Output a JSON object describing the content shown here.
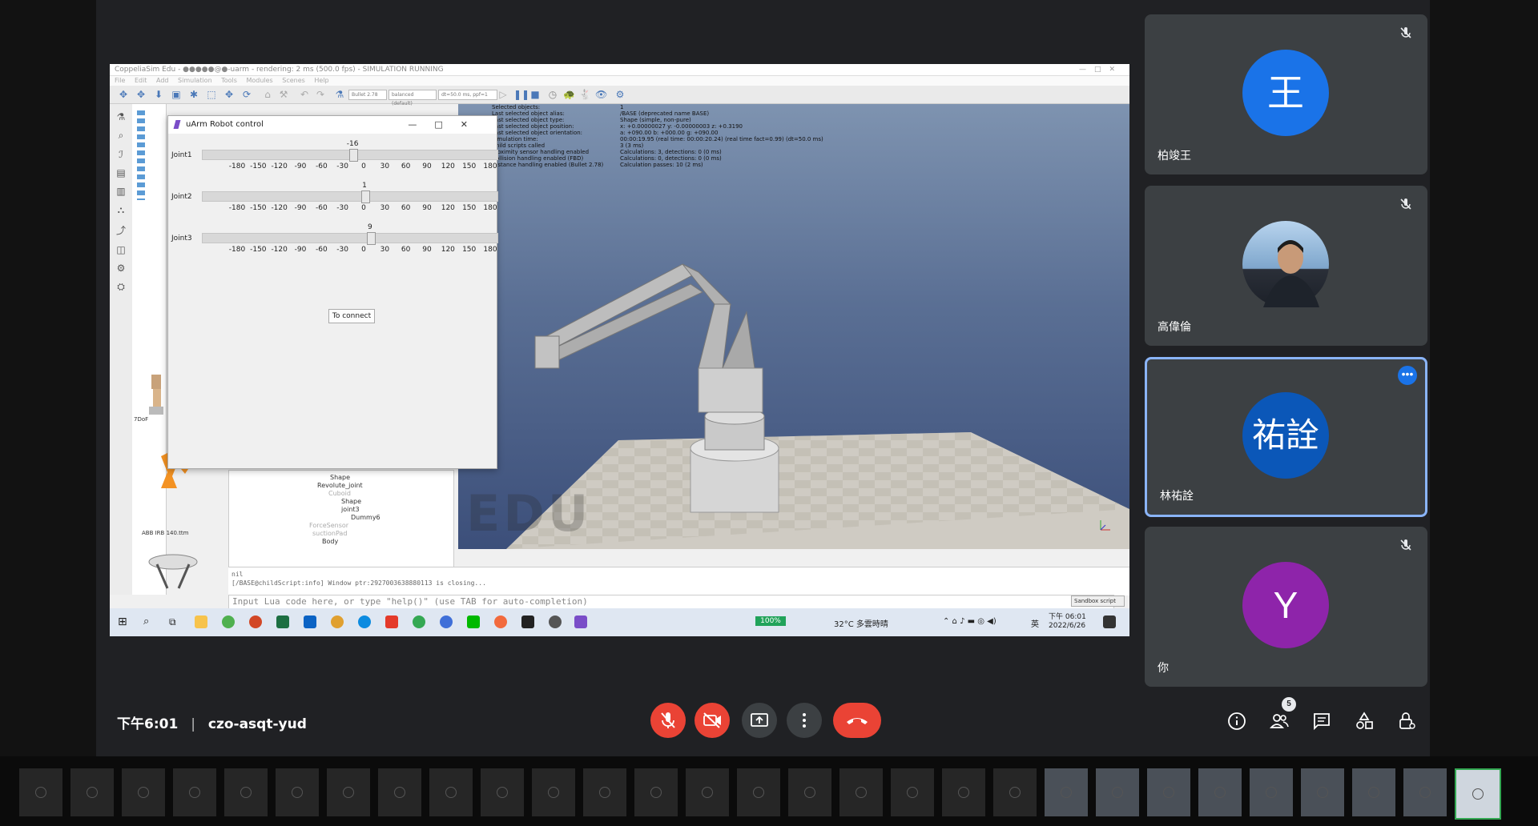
{
  "meeting": {
    "time": "下午6:01",
    "separator": "|",
    "code": "czo-asqt-yud",
    "participants_count": "5"
  },
  "participants": [
    {
      "name": "柏竣王",
      "initial": "王",
      "color": "#1a73e8",
      "muted": true
    },
    {
      "name": "高偉倫",
      "initial": "",
      "color": "#8aa7c4",
      "muted": true
    },
    {
      "name": "林祐詮",
      "initial": "祐詮",
      "color": "#0b57b8",
      "muted": false,
      "active": true
    },
    {
      "name": "你",
      "initial": "Y",
      "color": "#8e24aa",
      "muted": true
    }
  ],
  "controls": {
    "mic": "mic-off-icon",
    "camera": "camera-off-icon",
    "present": "present-screen-icon",
    "more": "more-options-icon",
    "leave": "leave-call-icon"
  },
  "colors": {
    "end_call": "#ea4335",
    "muted_red": "#ea4335",
    "tile_bg": "#3c4043",
    "active_border": "#8ab4f8"
  },
  "shared_screen": {
    "window_title": "CoppeliaSim Edu - ●●●●●@●-uarm - rendering: 2 ms (500.0 fps) - SIMULATION RUNNING",
    "menu": [
      "File",
      "Edit",
      "Add",
      "Simulation",
      "Tools",
      "Modules",
      "Scenes",
      "Help"
    ],
    "toolbar_combos": [
      "Bullet 2.78",
      "balanced (default)",
      "dt=50.0 ms, ppf=1"
    ],
    "uarm_window": {
      "title": "uArm Robot control",
      "joints": [
        {
          "label": "Joint1",
          "value": "-16",
          "fraction": 0.456
        },
        {
          "label": "Joint2",
          "value": "1",
          "fraction": 0.503
        },
        {
          "label": "Joint3",
          "value": "9",
          "fraction": 0.525
        }
      ],
      "ticks": [
        "-180",
        "-150",
        "-120",
        "-90",
        "-60",
        "-30",
        "0",
        "30",
        "60",
        "90",
        "120",
        "150",
        "180"
      ],
      "connect_button": "To connect"
    },
    "viewport_info_labels": [
      "Selected objects:",
      "Last selected object alias:",
      "Last selected object type:",
      "Last selected object position:",
      "Last selected object orientation:",
      "Simulation time:",
      "Child scripts called",
      "Proximity sensor handling enabled",
      "Collision handling enabled (FBD)",
      "Distance handling enabled (Bullet 2.78)"
    ],
    "viewport_info_values": [
      "1",
      "/BASE (deprecated name BASE)",
      "Shape (simple, non-pure)",
      "x: +0.00000027   y: -0.00000003   z: +0.3190",
      "a: +090.00   b: +000.00   g: +090.00",
      "00:00:19.95 (real time: 00:00:20.24) (real time fact=0.99) (dt=50.0 ms)",
      "3 (3 ms)",
      "Calculations: 3, detections: 0 (0 ms)",
      "Calculations: 0, detections: 0 (0 ms)",
      "Calculation passes: 10 (2 ms)"
    ],
    "watermark": "EDU",
    "model_labels": [
      "7DoF",
      "ABB IRB 140.ttm"
    ],
    "scene_tree": [
      "Shape",
      "Revolute_joint",
      "Cuboid",
      "Shape",
      "joint3",
      "Dummy6",
      "ForceSensor",
      "suctionPad",
      "Body"
    ],
    "console_lines": [
      "nil",
      "[/BASE@childScript:info] Window ptr:2927003638880113 is closing..."
    ],
    "lua_placeholder": "Input Lua code here, or type \"help()\" (use TAB for auto-completion)",
    "lua_combo": "Sandbox script",
    "taskbar": {
      "battery": "100%",
      "weather": "32°C 多雲時晴",
      "lang": "英",
      "time": "下午 06:01",
      "date": "2022/6/26"
    }
  },
  "filmstrip_count": 29
}
